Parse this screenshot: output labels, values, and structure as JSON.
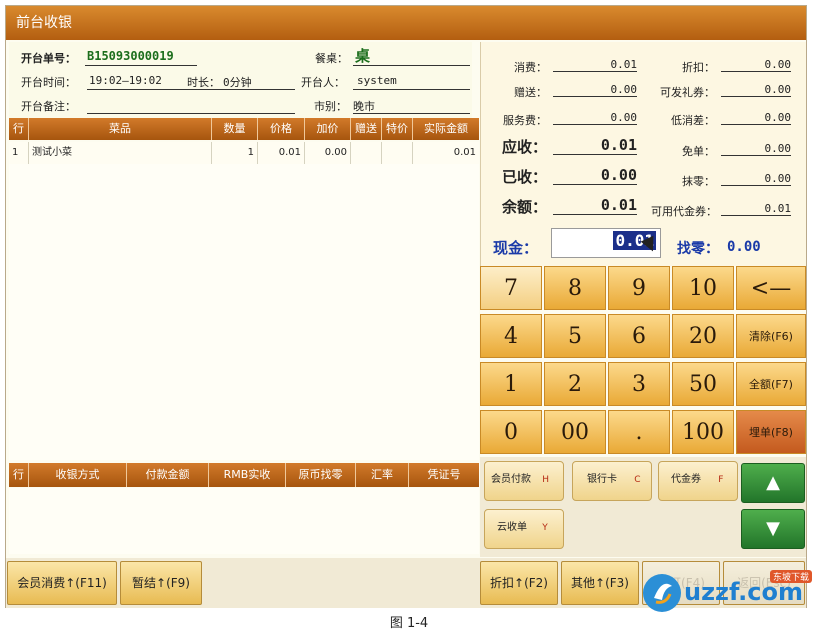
{
  "window": {
    "title": "前台收银"
  },
  "info": {
    "order_no_label": "开台单号：",
    "order_no": "B15093000019",
    "table_label": "餐桌：",
    "table": "桌",
    "time_label": "开台时间：",
    "time": "19:02—19:02",
    "duration_label": "时长：",
    "duration": "0分钟",
    "opener_label": "开台人：",
    "opener": "system",
    "remark_label": "开台备注：",
    "remark": "",
    "market_label": "市别：",
    "market": "晚市"
  },
  "items_table": {
    "headers": [
      "行",
      "菜品",
      "数量",
      "价格",
      "加价",
      "赠送",
      "特价",
      "实际金额"
    ],
    "rows": [
      [
        "1",
        "测试小菜",
        "1",
        "0.01",
        "0.00",
        "",
        "",
        "0.01"
      ]
    ]
  },
  "pay_table": {
    "headers": [
      "行",
      "收银方式",
      "付款金额",
      "RMB实收",
      "原币找零",
      "汇率",
      "凭证号"
    ]
  },
  "summary": {
    "consume_label": "消费：",
    "consume": "0.01",
    "discount_label": "折扣：",
    "discount": "0.00",
    "gift_label": "赠送：",
    "gift": "0.00",
    "giftcard_label": "可发礼券：",
    "giftcard": "0.00",
    "service_label": "服务费：",
    "service": "0.00",
    "lowcons_label": "低消差：",
    "lowcons": "0.00",
    "due_label": "应收：",
    "due": "0.01",
    "free_label": "免单：",
    "free": "0.00",
    "paid_label": "已收：",
    "paid": "0.00",
    "round_label": "抹零：",
    "round": "0.00",
    "balance_label": "余额：",
    "balance": "0.01",
    "voucher_label": "可用代金券：",
    "voucher": "0.01",
    "cash_label": "现金：",
    "cash": "0.01",
    "change_label": "找零：",
    "change": "0.00"
  },
  "keypad": {
    "rows": [
      [
        "7",
        "8",
        "9",
        "10",
        "<—"
      ],
      [
        "4",
        "5",
        "6",
        "20",
        "清除(F6)"
      ],
      [
        "1",
        "2",
        "3",
        "50",
        "全额(F7)"
      ],
      [
        "0",
        "00",
        ".",
        "100",
        "埋单(F8)"
      ]
    ]
  },
  "pay_methods": {
    "member": "会员付款",
    "member_key": "H",
    "bank": "银行卡",
    "bank_key": "C",
    "voucher": "代金券",
    "voucher_key": "F",
    "cloud": "云收单",
    "cloud_key": "Y"
  },
  "bottom": {
    "member_consume": "会员消费↑(F11)",
    "temp_settle": "暂结↑(F9)",
    "discount_btn": "折扣↑(F2)",
    "other_btn": "其他↑(F3)",
    "dim1": "预打(F4)",
    "dim2": "返回(Esc)"
  },
  "caption": "图 1-4",
  "watermark": {
    "text": "uzzf.com",
    "sub": "东坡下载"
  },
  "colors": {
    "accent": "#b35e10",
    "key": "#e9a936",
    "green": "#22752a"
  }
}
